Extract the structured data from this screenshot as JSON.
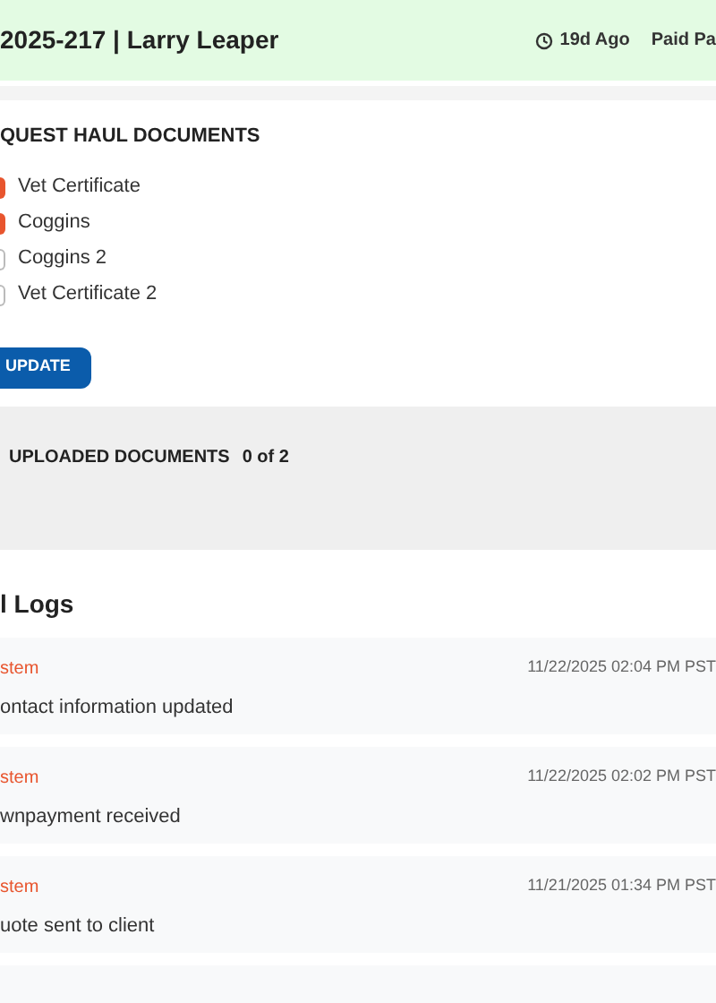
{
  "header": {
    "title": "2025-217 | Larry Leaper",
    "age": "19d Ago",
    "status": "Paid Pa"
  },
  "request_section": {
    "title": "QUEST HAUL DOCUMENTS",
    "documents": [
      {
        "label": "Vet Certificate",
        "checked": true
      },
      {
        "label": "Coggins",
        "checked": true
      },
      {
        "label": "Coggins 2",
        "checked": false
      },
      {
        "label": "Vet Certificate 2",
        "checked": false
      }
    ],
    "button": "UPDATE"
  },
  "uploaded": {
    "title": "UPLOADED DOCUMENTS",
    "count": "0 of 2"
  },
  "logs": {
    "title": "l Logs",
    "entries": [
      {
        "author": "stem",
        "time": "11/22/2025 02:04 PM PST",
        "message": "ontact information updated"
      },
      {
        "author": "stem",
        "time": "11/22/2025 02:02 PM PST",
        "message": "wnpayment received"
      },
      {
        "author": "stem",
        "time": "11/21/2025 01:34 PM PST",
        "message": "uote sent to client"
      }
    ]
  }
}
